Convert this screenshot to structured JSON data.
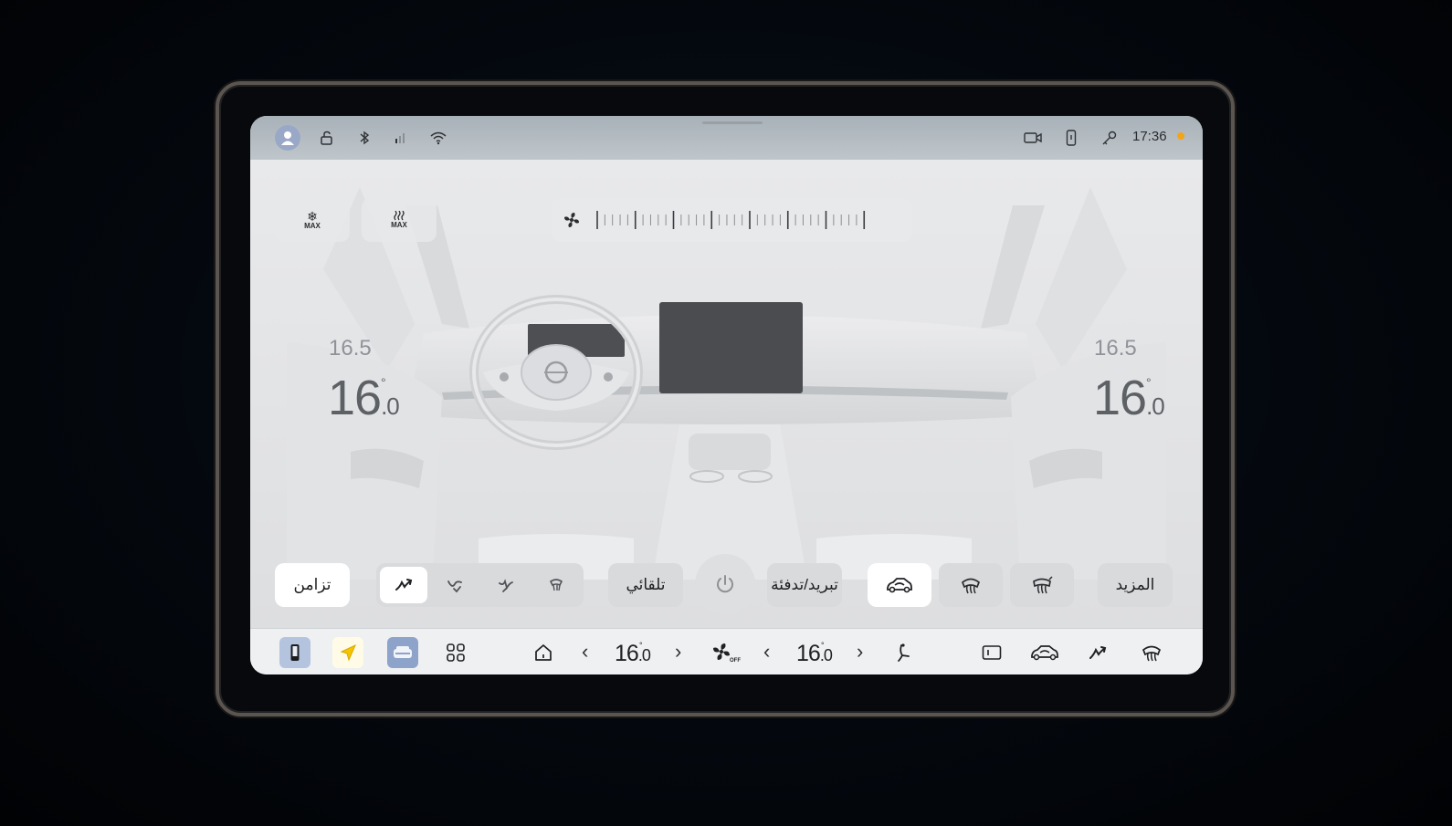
{
  "status_bar": {
    "time": "17:36",
    "icons": [
      "avatar-icon",
      "unlock-icon",
      "bluetooth-icon",
      "signal-icon",
      "wifi-icon",
      "camera-icon",
      "phone-icon",
      "key-icon",
      "notification-dot"
    ]
  },
  "top_controls": {
    "max_cool_label": "MAX",
    "max_heat_label": "MAX",
    "fan_icon": "fan-icon"
  },
  "temperatures": {
    "driver": {
      "target": "16.5",
      "current_int": "16",
      "current_dec": ".0",
      "unit": "°"
    },
    "passenger": {
      "target": "16.5",
      "current_int": "16",
      "current_dec": ".0",
      "unit": "°"
    }
  },
  "control_row": {
    "sync_label": "تزامن",
    "auto_label": "تلقائي",
    "cool_heat_label": "تبريد/تدفئة",
    "more_label": "المزيد"
  },
  "dock": {
    "driver_temp_int": "16",
    "driver_temp_dec": ".0",
    "passenger_temp_int": "16",
    "passenger_temp_dec": ".0",
    "deg": "°",
    "fan_state": "OFF",
    "chevron_left": "‹",
    "chevron_right": "›"
  },
  "colors": {
    "accent_yellow": "#f5c400",
    "accent_blue": "#8ea3c9",
    "status_orange": "#f2a516"
  }
}
